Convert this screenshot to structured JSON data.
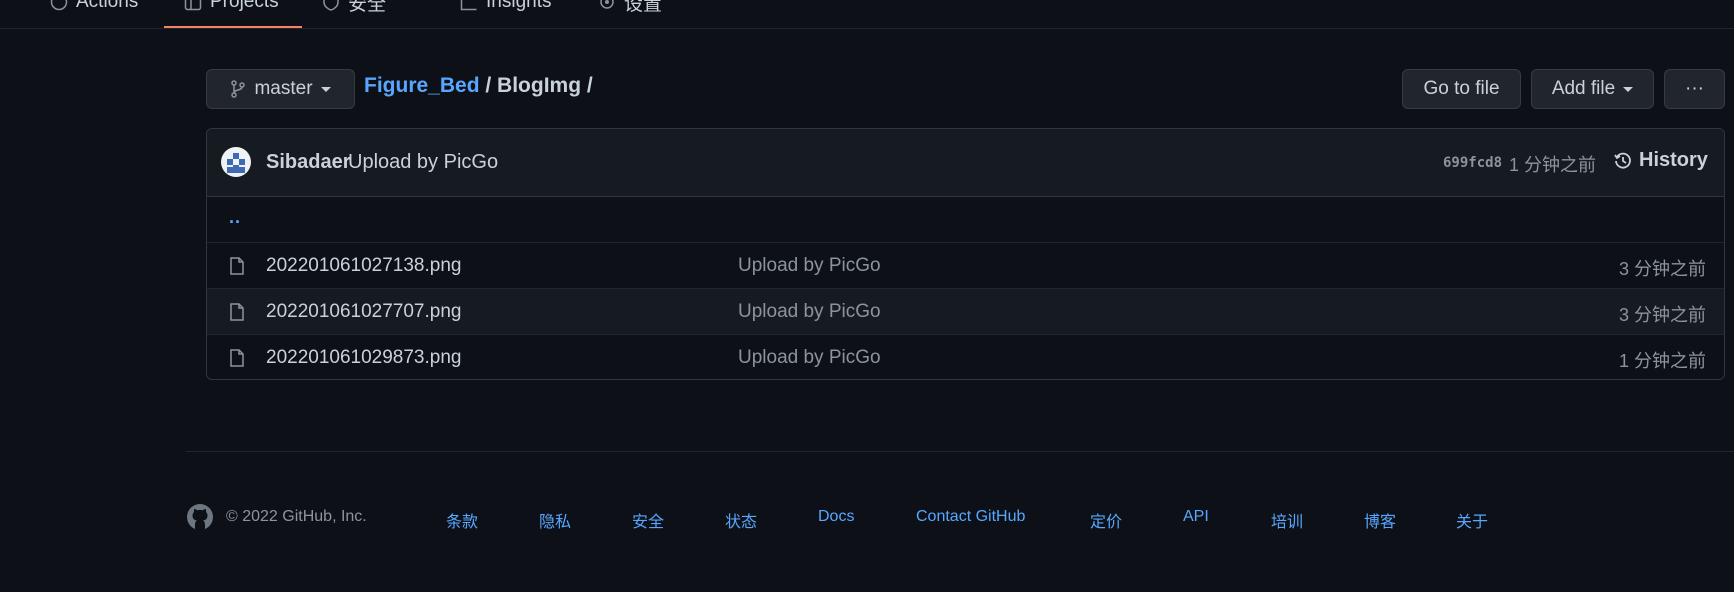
{
  "tabs": {
    "actions": "Actions",
    "projects": "Projects",
    "security": "安全",
    "insights": "Insights",
    "settings": "设置"
  },
  "repo_nav": {
    "branch": "master",
    "breadcrumb_repo": "Figure_Bed",
    "breadcrumb_sep1": " / ",
    "breadcrumb_folder": "BlogImg",
    "breadcrumb_sep2": " /",
    "go_to_file": "Go to file",
    "add_file": "Add file",
    "more": "···"
  },
  "commit": {
    "author": "Sibadaer",
    "message": "Upload by PicGo",
    "sha": "699fcd8",
    "time_ago": "1 分钟之前",
    "history_label": "History"
  },
  "files": {
    "updir": "..",
    "rows": [
      {
        "name": "202201061027138.png",
        "message": "Upload by PicGo",
        "age": "3 分钟之前"
      },
      {
        "name": "202201061027707.png",
        "message": "Upload by PicGo",
        "age": "3 分钟之前"
      },
      {
        "name": "202201061029873.png",
        "message": "Upload by PicGo",
        "age": "1 分钟之前"
      }
    ]
  },
  "footer": {
    "copyright": "© 2022 GitHub, Inc.",
    "links": [
      "条款",
      "隐私",
      "安全",
      "状态",
      "Docs",
      "Contact GitHub",
      "定价",
      "API",
      "培训",
      "博客",
      "关于"
    ]
  },
  "colors": {
    "background": "#0d1117",
    "link": "#58a6ff",
    "muted": "#8b949e",
    "border": "#30363d"
  }
}
